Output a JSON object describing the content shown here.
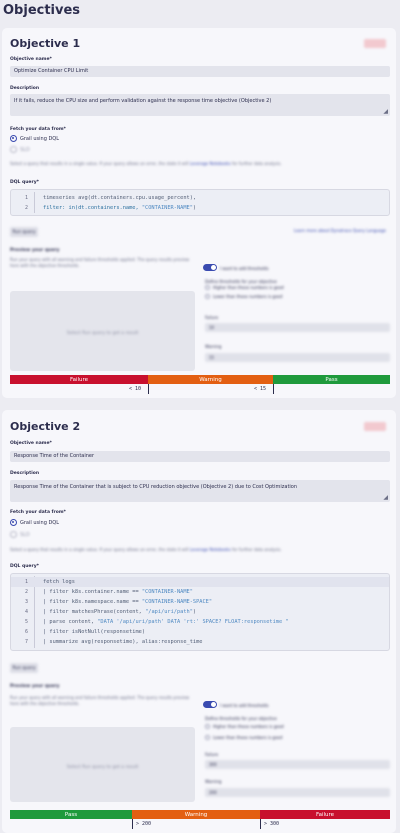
{
  "page": {
    "title": "Objectives"
  },
  "colors": {
    "accent": "#3a4bb0",
    "failure": "#c8102e",
    "warning": "#e35f12",
    "pass": "#1f9a3c",
    "delete": "#f2c9cf"
  },
  "objectives": [
    {
      "title": "Objective 1",
      "delete_label": "Delete",
      "name_label": "Objective name*",
      "name_value": "Optimize Container CPU Limit",
      "description_label": "Description",
      "description_value": "If it fails, reduce the CPU size and perform validation against the response time objective (Objective 2)",
      "fetch_label": "Fetch your data from*",
      "source_grail": "Grail using DQL",
      "source_other": "SLO",
      "help_text": "Select a query that results in a single value. If your query allows an error, the state it will",
      "help_link": "Leverage Notebooks",
      "help_tail": "for further data analysis.",
      "dql_label": "DQL query*",
      "code": [
        {
          "n": "1",
          "pre": "timeseries avg(dt.containers.cpu.usage_percent),",
          "str": "",
          "post": ""
        },
        {
          "n": "2",
          "pre": "filter: in(dt.containers.name, ",
          "str": "\"CONTAINER-NAME\"",
          "post": ")"
        }
      ],
      "run_label": "Run query",
      "learn_link": "Learn more about Dynatrace Query Language",
      "preview_label": "Preview your query",
      "preview_help": "Run your query with all warning and failure thresholds applied. The query results preview here with the objective thresholds.",
      "preview_placeholder": "Select Run query to get a result",
      "toggle_label": "I want to add thresholds",
      "define_label": "Define thresholds for your objective",
      "opt_higher": "Higher than these numbers is good",
      "opt_lower": "Lower than these numbers is good",
      "failure_label": "Failure",
      "failure_value": "10",
      "warning_label": "Warning",
      "warning_value": "15",
      "bar": {
        "left": "Failure",
        "mid": "Warning",
        "right": "Pass",
        "t1": "< 10",
        "t2": "< 15"
      }
    },
    {
      "title": "Objective 2",
      "delete_label": "Delete",
      "name_label": "Objective name*",
      "name_value": "Response Time of the Container",
      "description_label": "Description",
      "description_value": "Response Time of the Container that is subject to CPU reduction objective (Objective 2) due to Cost Optimization",
      "fetch_label": "Fetch your data from*",
      "source_grail": "Grail using DQL",
      "source_other": "SLO",
      "help_text": "Select a query that results in a single value. If your query allows an error, the state it will",
      "help_link": "Leverage Notebooks",
      "help_tail": "for further data analysis.",
      "dql_label": "DQL query*",
      "code": [
        {
          "n": "1",
          "pre": "fetch logs",
          "str": "",
          "post": ""
        },
        {
          "n": "2",
          "pre": "| filter k8s.container.name == ",
          "str": "\"CONTAINER-NAME\"",
          "post": ""
        },
        {
          "n": "3",
          "pre": "| filter k8s.namespace.name == ",
          "str": "\"CONTAINER-NAME-SPACE\"",
          "post": ""
        },
        {
          "n": "4",
          "pre": "| filter matchesPhrase(content, ",
          "str": "\"/api/uri/path\"",
          "post": ")"
        },
        {
          "n": "5",
          "pre": "| parse content, ",
          "str": "\"DATA '/api/uri/path' DATA 'rt:' SPACE? FLOAT:responsetime \"",
          "post": ""
        },
        {
          "n": "6",
          "pre": "| filter isNotNull(responsetime)",
          "str": "",
          "post": ""
        },
        {
          "n": "7",
          "pre": "| summarize avg(responsetime), alias:response_time",
          "str": "",
          "post": ""
        }
      ],
      "run_label": "Run query",
      "learn_link": "Learn more about Dynatrace Query Language",
      "preview_label": "Preview your query",
      "preview_help": "Run your query with all warning and failure thresholds applied. The query results preview here with the objective thresholds.",
      "preview_placeholder": "Select Run query to get a result",
      "toggle_label": "I want to add thresholds",
      "define_label": "Define thresholds for your objective",
      "opt_higher": "Higher than these numbers is good",
      "opt_lower": "Lower than these numbers is good",
      "failure_label": "Failure",
      "failure_value": "300",
      "warning_label": "Warning",
      "warning_value": "200",
      "bar": {
        "left": "Pass",
        "mid": "Warning",
        "right": "Failure",
        "t1": "> 200",
        "t2": "> 300"
      }
    }
  ]
}
